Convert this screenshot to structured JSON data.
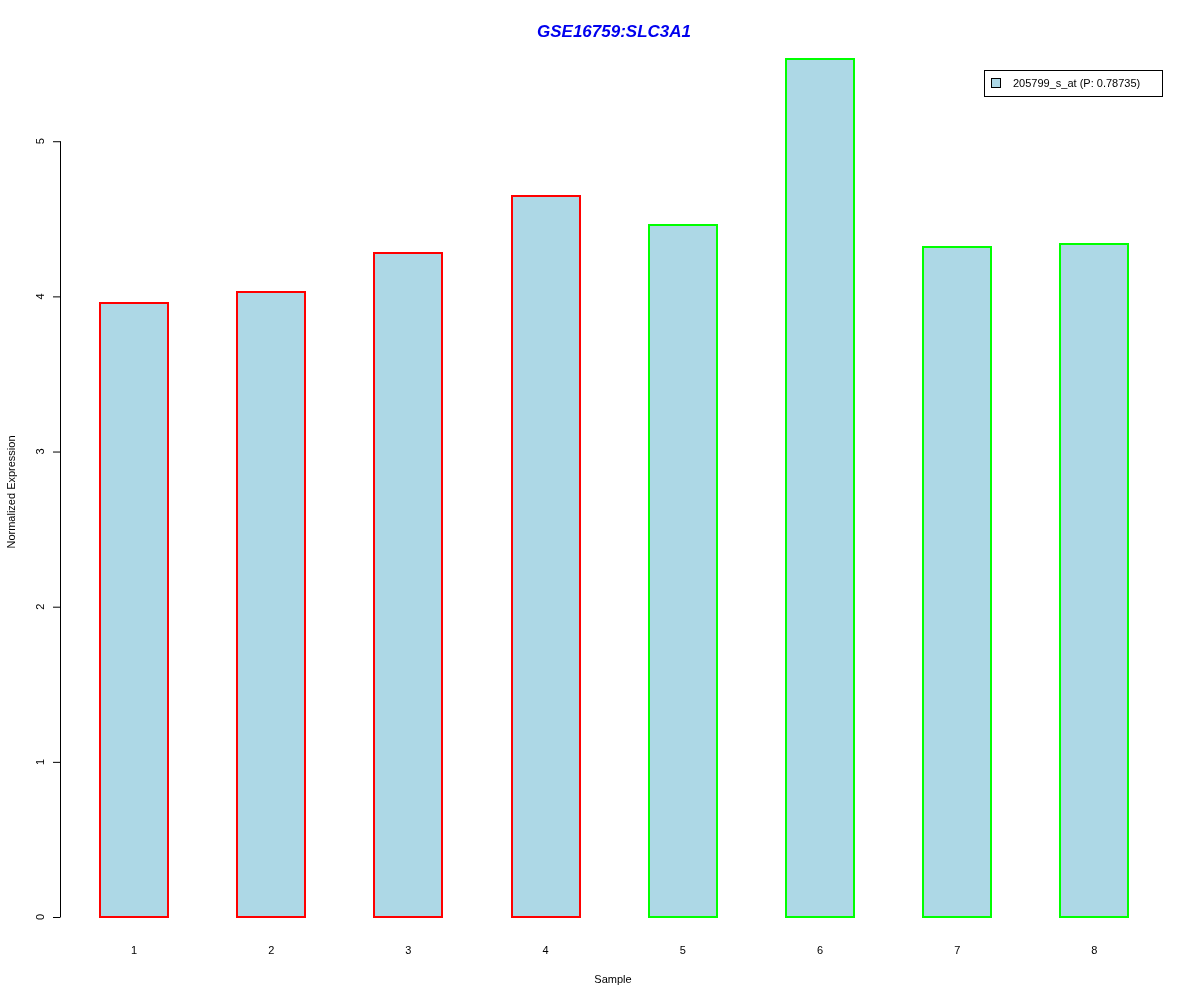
{
  "plot": {
    "chart_data": {
      "type": "bar",
      "title": "GSE16759:SLC3A1",
      "xlabel": "Sample",
      "ylabel": "Normalized Expression",
      "categories": [
        "1",
        "2",
        "3",
        "4",
        "5",
        "6",
        "7",
        "8"
      ],
      "series": [
        {
          "name": "205799_s_at (P: 0.78735)",
          "color": "#add8e6",
          "values": [
            3.96,
            4.03,
            4.28,
            4.65,
            4.46,
            5.53,
            4.32,
            4.34
          ]
        }
      ],
      "ylim": [
        0,
        5.53
      ],
      "yticks": [
        0,
        1,
        2,
        3,
        4,
        5
      ]
    },
    "bar_outlines": [
      {
        "color": "#ff0000"
      },
      {
        "color": "#ff0000"
      },
      {
        "color": "#ff0000"
      },
      {
        "color": "#ff0000"
      },
      {
        "color": "#00ff00"
      },
      {
        "color": "#00ff00"
      },
      {
        "color": "#00ff00"
      },
      {
        "color": "#00ff00"
      }
    ]
  }
}
